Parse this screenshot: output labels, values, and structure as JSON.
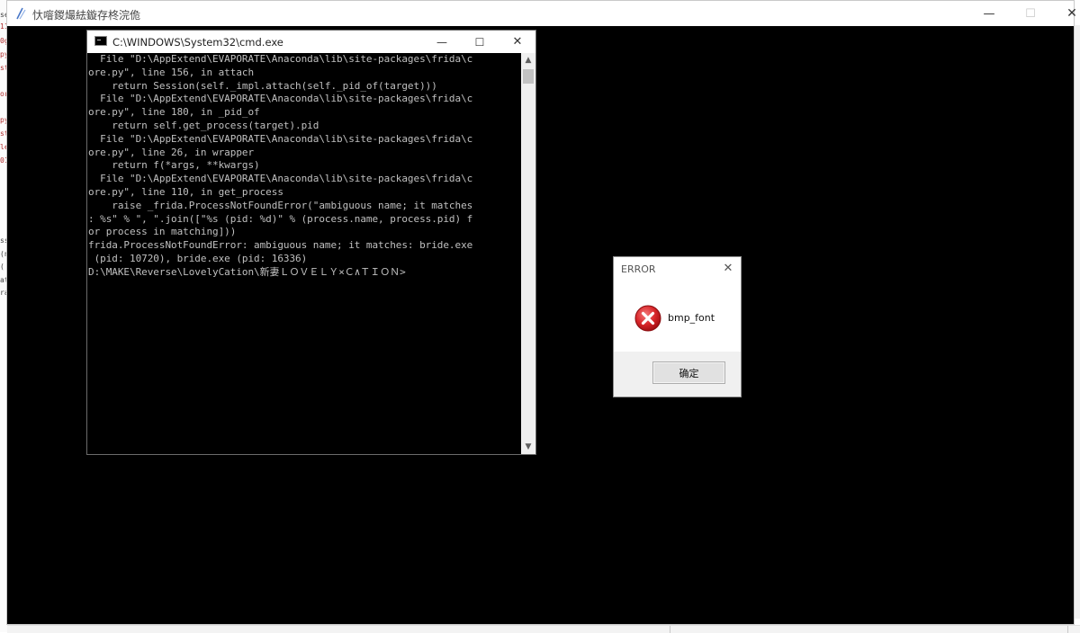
{
  "game_window": {
    "title": "忕噾鍐熶紶鏇存柊浣佹",
    "controls": {
      "minimize": "—",
      "maximize": "☐",
      "close": "✕"
    }
  },
  "cmd_window": {
    "title": "C:\\WINDOWS\\System32\\cmd.exe",
    "controls": {
      "minimize": "—",
      "maximize": "☐",
      "close": "✕"
    },
    "lines": [
      "  File \"D:\\AppExtend\\EVAPORATE\\Anaconda\\lib\\site-packages\\frida\\c",
      "ore.py\", line 156, in attach",
      "    return Session(self._impl.attach(self._pid_of(target)))",
      "  File \"D:\\AppExtend\\EVAPORATE\\Anaconda\\lib\\site-packages\\frida\\c",
      "ore.py\", line 180, in _pid_of",
      "    return self.get_process(target).pid",
      "  File \"D:\\AppExtend\\EVAPORATE\\Anaconda\\lib\\site-packages\\frida\\c",
      "ore.py\", line 26, in wrapper",
      "    return f(*args, **kwargs)",
      "  File \"D:\\AppExtend\\EVAPORATE\\Anaconda\\lib\\site-packages\\frida\\c",
      "ore.py\", line 110, in get_process",
      "    raise _frida.ProcessNotFoundError(\"ambiguous name; it matches",
      ": %s\" % \", \".join([\"%s (pid: %d)\" % (process.name, process.pid) f",
      "or process in matching]))",
      "frida.ProcessNotFoundError: ambiguous name; it matches: bride.exe",
      " (pid: 10720), bride.exe (pid: 16336)",
      "",
      "D:\\MAKE\\Reverse\\LovelyCation\\新妻ＬＯＶＥＬＹ×Ｃ∧ＴＩＯＮ>"
    ],
    "scrollbar": {
      "up": "▲",
      "down": "▼"
    }
  },
  "error_dialog": {
    "title": "ERROR",
    "close": "✕",
    "message": "bmp_font",
    "ok_label": "确定",
    "icon": "error-circle-icon"
  },
  "background_editor_fragments": [
    "se",
    "11",
    "0g",
    "py",
    "st",
    "or",
    "py",
    "st",
    "le",
    "01",
    "ss",
    "(n",
    "(",
    "at",
    "ra"
  ]
}
